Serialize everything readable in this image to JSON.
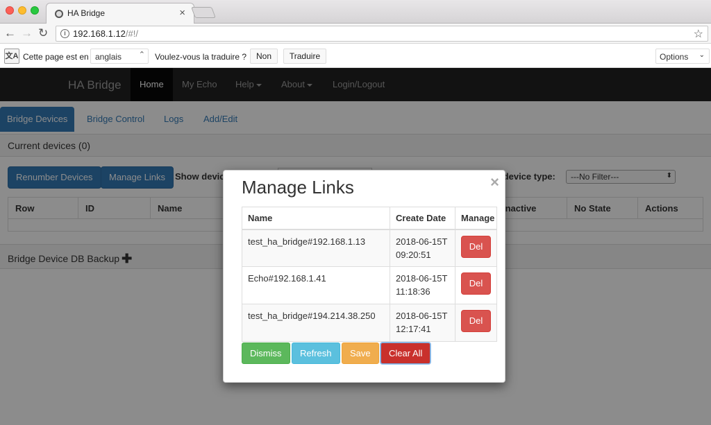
{
  "browser": {
    "tab_title": "HA Bridge",
    "url_host": "192.168.1.12",
    "url_path": "/#!/"
  },
  "translate_bar": {
    "prefix": "Cette page est en",
    "language": "anglais",
    "question": "Voulez-vous la traduire ?",
    "no_label": "Non",
    "translate_label": "Traduire",
    "options_label": "Options"
  },
  "navbar": {
    "brand": "HA Bridge",
    "items": [
      {
        "label": "Home"
      },
      {
        "label": "My Echo"
      },
      {
        "label": "Help"
      },
      {
        "label": "About"
      },
      {
        "label": "Login/Logout"
      }
    ]
  },
  "tabs": [
    {
      "label": "Bridge Devices"
    },
    {
      "label": "Bridge Control"
    },
    {
      "label": "Logs"
    },
    {
      "label": "Add/Edit"
    }
  ],
  "devices_panel": {
    "title": "Current devices (0)",
    "renumber_label": "Renumber Devices",
    "manage_links_label": "Manage Links",
    "show_devices_label": "Show devic",
    "filter_label": "r device type:",
    "filter_value": "---No Filter---",
    "columns": [
      "Row",
      "ID",
      "Name",
      "Inactive",
      "No State",
      "Actions"
    ]
  },
  "backup_panel": {
    "title": "Bridge Device DB Backup"
  },
  "modal": {
    "title": "Manage Links",
    "close_glyph": "×",
    "columns": [
      "Name",
      "Create Date",
      "Manage"
    ],
    "rows": [
      {
        "name": "test_ha_bridge#192.168.1.13",
        "date": "2018-06-15T09:20:51",
        "action": "Del"
      },
      {
        "name": "Echo#192.168.1.41",
        "date": "2018-06-15T11:18:36",
        "action": "Del"
      },
      {
        "name": "test_ha_bridge#194.214.38.250",
        "date": "2018-06-15T12:17:41",
        "action": "Del"
      }
    ],
    "buttons": {
      "dismiss": "Dismiss",
      "refresh": "Refresh",
      "save": "Save",
      "clear_all": "Clear All"
    }
  }
}
